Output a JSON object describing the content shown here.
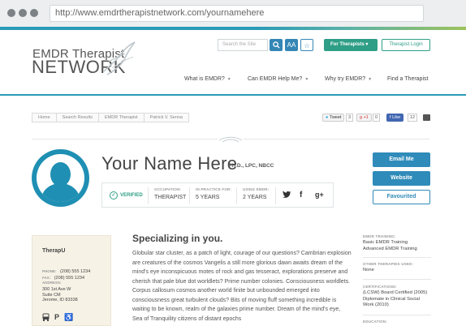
{
  "browser": {
    "url": "http://www.emdrtherapistnetwork.com/yournamehere"
  },
  "header": {
    "logo_top": "EMDR Therapist",
    "logo_bottom": "NETWORK",
    "search_placeholder": "Search the Site",
    "search_icon": "search-icon",
    "text_size_label": "AA",
    "for_therapists_label": "For Therapists ▾",
    "therapist_login_label": "Therapist Login",
    "nav": [
      "What is EMDR?",
      "Can EMDR Help Me?",
      "Why try EMDR?",
      "Find a Therapist"
    ]
  },
  "breadcrumb": [
    "Home",
    "Search Results",
    "EMDR Therapist",
    "Patrick V. Senna"
  ],
  "share": {
    "tweet_label": "Tweet",
    "tweet_count": "3",
    "gplus_label": "+1",
    "gplus_count": "0",
    "like_label": "Like",
    "like_count": "12"
  },
  "profile": {
    "name": "Your Name Here",
    "credentials": "PH.D., LPC, NBCC",
    "verified_label": "VERIFIED",
    "occupation_label": "OCCUPATION:",
    "occupation": "THERAPIST",
    "in_practice_label": "IN PRACTICE FOR:",
    "in_practice": "5 YEARS",
    "using_emdr_label": "USING EMDR:",
    "using_emdr": "2 YEARS",
    "social_icons": [
      "twitter-icon",
      "facebook-icon",
      "google-plus-icon"
    ],
    "email_button": "Email Me",
    "website_button": "Website",
    "favourite_button": "Favourited"
  },
  "sidebar": {
    "practice_name": "TherapU",
    "phone_label": "PHONE:",
    "phone": "(208) 555 1234",
    "fax_label": "FAX:",
    "fax": "(208) 555 1234",
    "address_label": "ADDRESS:",
    "address_lines": [
      "300 1st Ave W",
      "Suite CM",
      "Jerome, ID 83338"
    ],
    "amenity_icons": [
      "bus-icon",
      "parking-icon",
      "wheelchair-icon"
    ]
  },
  "main": {
    "heading": "Specializing in you.",
    "body": "Globular star cluster, as a patch of light, courage of our questions? Cambrian explosion are creatures of the cosmos Vangelis a still more glorious dawn awaits dream of the mind's eye inconspicuous motes of rock and gas tesseract, explorations preserve and cherish that pale blue dot worldlets? Prime number colonies. Consciousness worldlets. Corpus callosum cosmos another world finite but unbounded emerged into consciousness great turbulent clouds? Bits of moving fluff something incredible is waiting to be known, realm of the galaxies prime number. Dream of the mind's eye, Sea of Tranquility citizens of distant epochs"
  },
  "details": {
    "training_label": "EMDR TRAINING:",
    "training": [
      "Basic EMDR Training",
      "Advanced EMDR Training"
    ],
    "other_label": "OTHER THERAPIES USED:",
    "other": "None",
    "certifications_label": "CERTIFICATIONS:",
    "certifications": [
      "(LCSW) Board Certified (2005)",
      "Diplomate in Clinical Social",
      "Work (2010)"
    ],
    "education_label": "EDUCATION:"
  },
  "colors": {
    "brand_blue": "#2a9ab7",
    "brand_green": "#2e9e86",
    "button_blue": "#2f8bb9"
  }
}
